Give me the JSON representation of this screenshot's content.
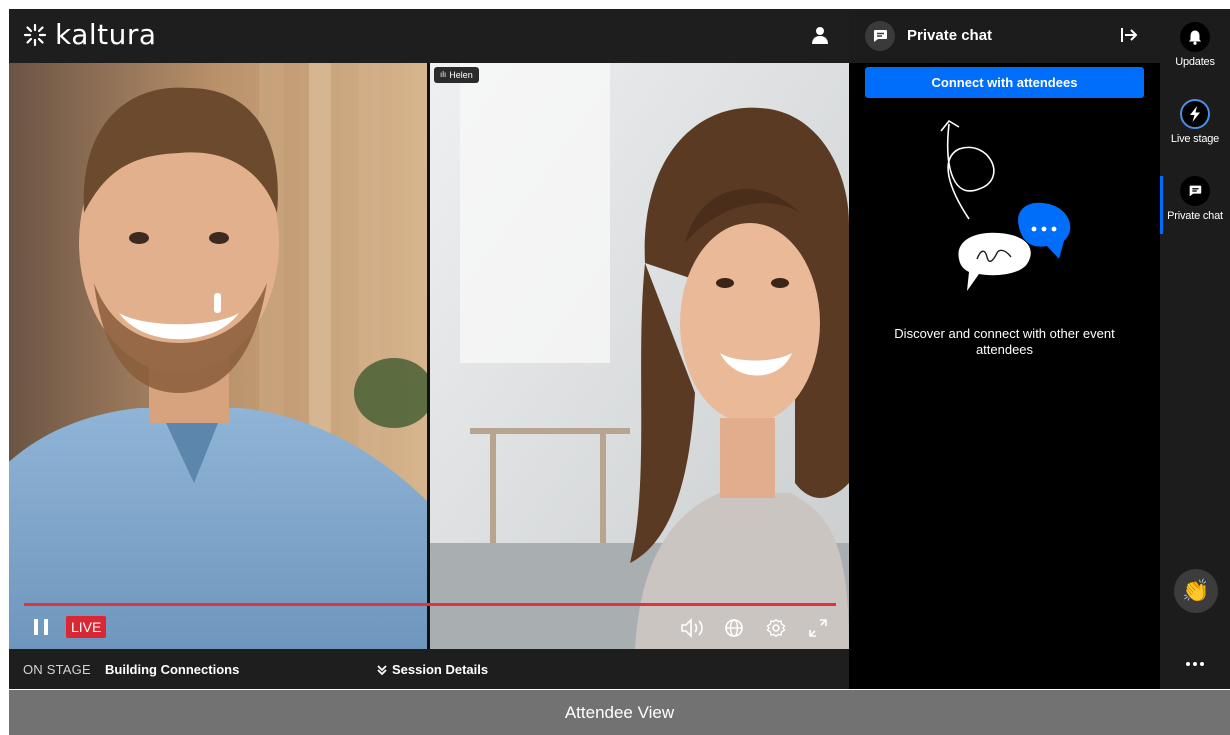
{
  "app": {
    "logo_text": "kaltura",
    "user_icon": "user-icon"
  },
  "video": {
    "speaker_tag": "Helen",
    "live_label": "LIVE",
    "progress_percent": 100,
    "progress_color": "#e0333e",
    "controls": [
      "pause-icon",
      "volume-icon",
      "globe-icon",
      "settings-icon",
      "fullscreen-icon"
    ]
  },
  "stage": {
    "label": "ON STAGE",
    "title": "Building Connections",
    "session_details": "Session Details"
  },
  "chat": {
    "title": "Private chat",
    "connect_button": "Connect with attendees",
    "empty_text": "Discover and connect with other event attendees",
    "accent_color": "#006efa"
  },
  "rail": {
    "items": [
      {
        "label": "Updates",
        "icon": "bell-icon"
      },
      {
        "label": "Live stage",
        "icon": "lightning-icon"
      },
      {
        "label": "Private chat",
        "icon": "chat-icon"
      }
    ],
    "reaction_icon": "clapping-hands-icon",
    "more_icon": "more-icon"
  },
  "caption": {
    "text": "Attendee View"
  }
}
